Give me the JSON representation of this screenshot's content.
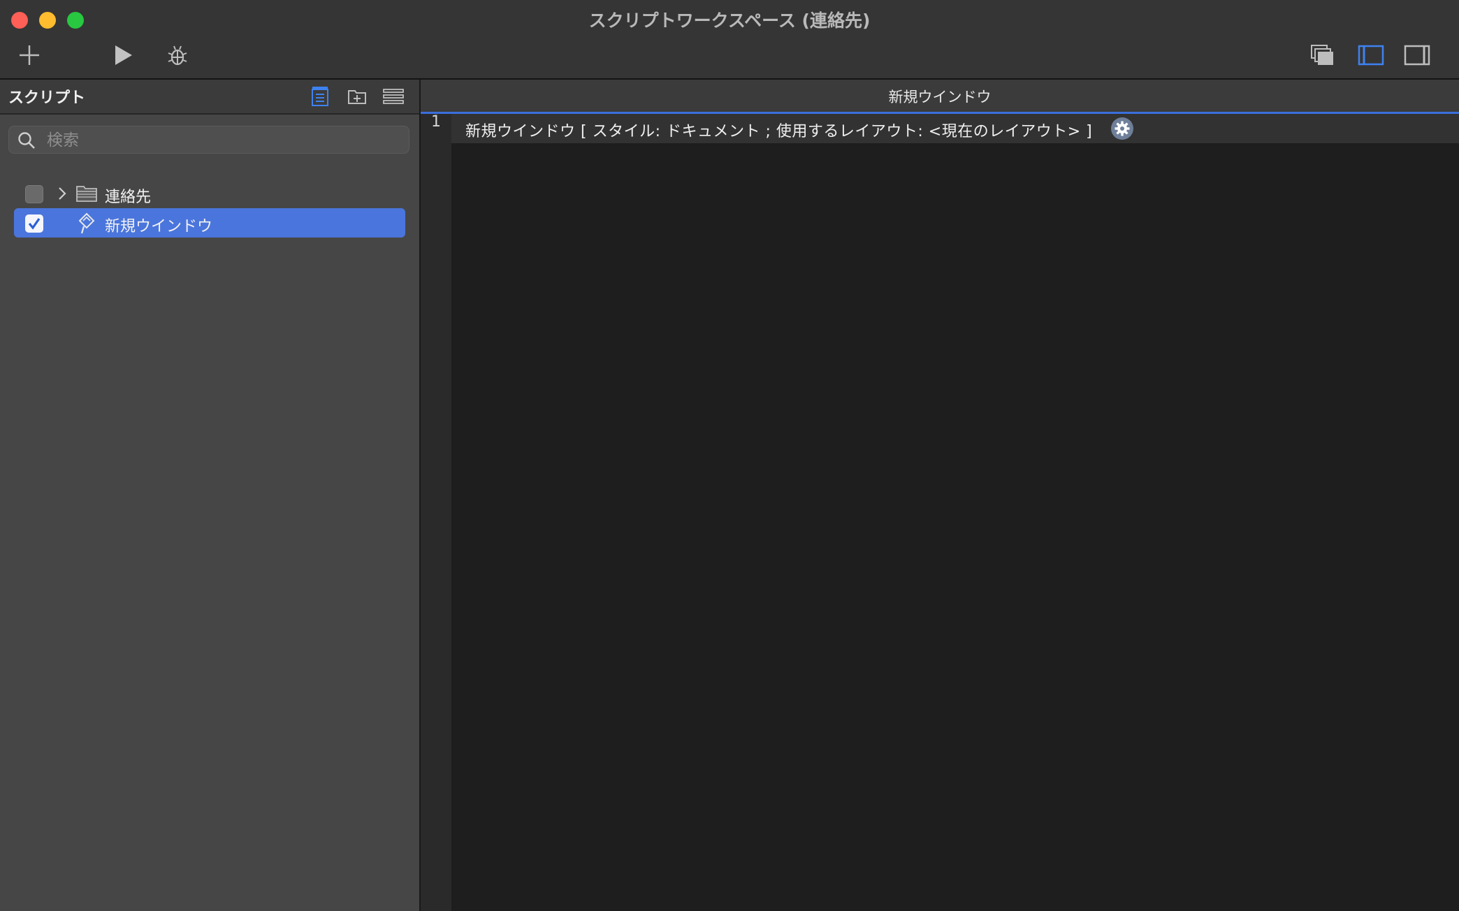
{
  "window": {
    "title": "スクリプトワークスペース (連絡先)"
  },
  "toolbar": {
    "buttons": [
      {
        "name": "plus-icon"
      },
      {
        "name": "play-icon"
      },
      {
        "name": "bug-icon"
      },
      {
        "name": "window-stack-icon"
      },
      {
        "name": "left-pane-icon"
      },
      {
        "name": "right-pane-icon"
      }
    ]
  },
  "sidebar": {
    "title": "スクリプト",
    "search": {
      "placeholder": "検索",
      "value": ""
    },
    "items": [
      {
        "label": "連絡先",
        "type": "folder",
        "checked": false,
        "expanded": false
      },
      {
        "label": "新規ウインドウ",
        "type": "script",
        "checked": true,
        "selected": true
      }
    ]
  },
  "editor": {
    "title": "新規ウインドウ",
    "lines": [
      {
        "number": "1",
        "text": "新規ウインドウ [ スタイル: ドキュメント ; 使用するレイアウト: <現在のレイアウト> ]"
      }
    ]
  },
  "colors": {
    "accent": "#4a75dc",
    "close": "#fe5f57",
    "minimize": "#febc2e",
    "zoom": "#28c840"
  }
}
